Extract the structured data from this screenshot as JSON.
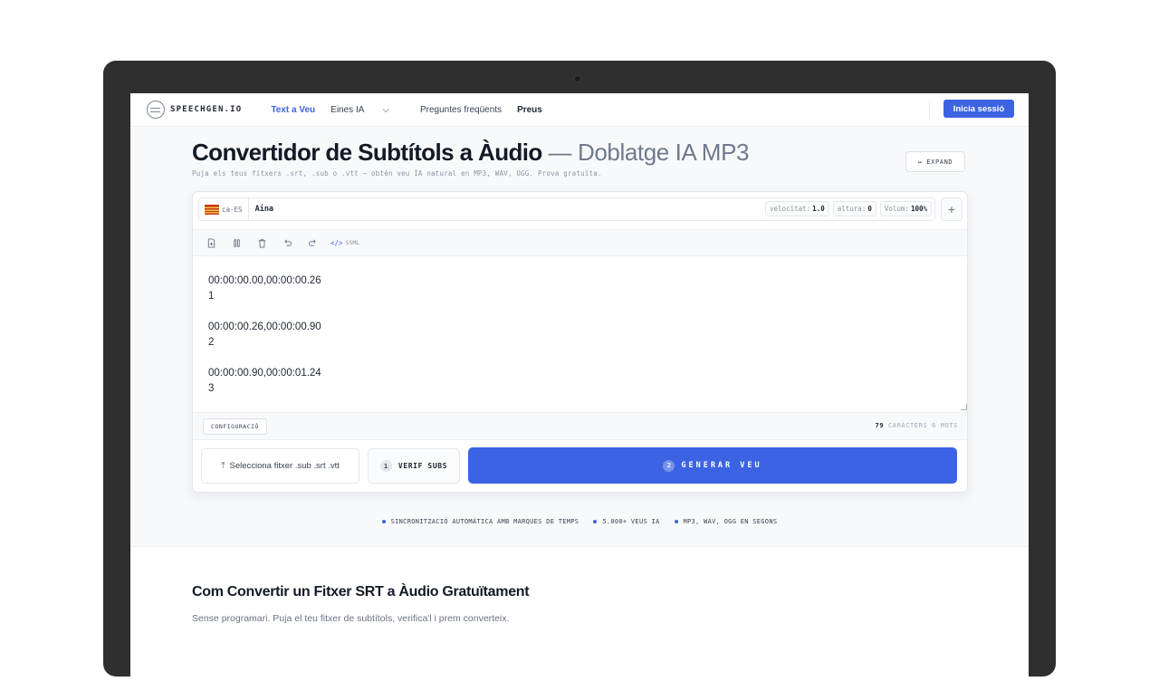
{
  "header": {
    "logo_text": "SPEECHGEN.IO",
    "nav": [
      {
        "label": "Text a Veu"
      },
      {
        "label": "Eines IA"
      },
      {
        "label": "Preguntes freqüents"
      },
      {
        "label": "Preus"
      }
    ],
    "login_label": "Inicia sessió"
  },
  "hero": {
    "title_strong": "Convertidor de Subtítols a Àudio",
    "title_light": " — Doblatge IA MP3",
    "subtitle": "Puja els teus fitxers .srt, .sub o .vtt — obtén veu IA natural en MP3, WAV, OGG. Prova gratuïta.",
    "expand_label": "↔ EXPAND"
  },
  "voice_bar": {
    "lang": "ca-ES",
    "voice": "Aina",
    "params": [
      {
        "label": "velocitat:",
        "value": "1.0"
      },
      {
        "label": "altura:",
        "value": "0"
      },
      {
        "label": "Volum:",
        "value": "100%"
      }
    ],
    "add_label": "+"
  },
  "toolbar": {
    "ssml_code": "</>",
    "ssml_label": "SSML"
  },
  "editor": {
    "lines": [
      "00:00:00.00,00:00:00.26",
      "1",
      "",
      "00:00:00.26,00:00:00.90",
      "2",
      "",
      "00:00:00.90,00:00:01.24",
      "3"
    ]
  },
  "status": {
    "config_label": "CONFIGURACIÓ",
    "char_count": "79",
    "count_suffix": "CARÀCTERS 6 MOTS"
  },
  "actions": {
    "file_label": "Selecciona fitxer .sub .srt .vtt",
    "verif_num": "1",
    "verif_label": "VERIF SUBS",
    "gen_num": "2",
    "gen_label": "GENERAR VEU"
  },
  "features": [
    "SINCRONITZACIÓ AUTOMÀTICA AMB MARQUES DE TEMPS",
    "5.000+ VEUS IA",
    "MP3, WAV, OGG EN SEGONS"
  ],
  "section": {
    "title": "Com Convertir un Fitxer SRT a Àudio Gratuïtament",
    "subtitle": "Sense programari. Puja el teu fitxer de subtítols, verifica'l i prem converteix."
  },
  "colors": {
    "accent": "#3b63e3",
    "text": "#141a26",
    "muted": "#6b7384",
    "bezel": "#2f2f2f"
  }
}
